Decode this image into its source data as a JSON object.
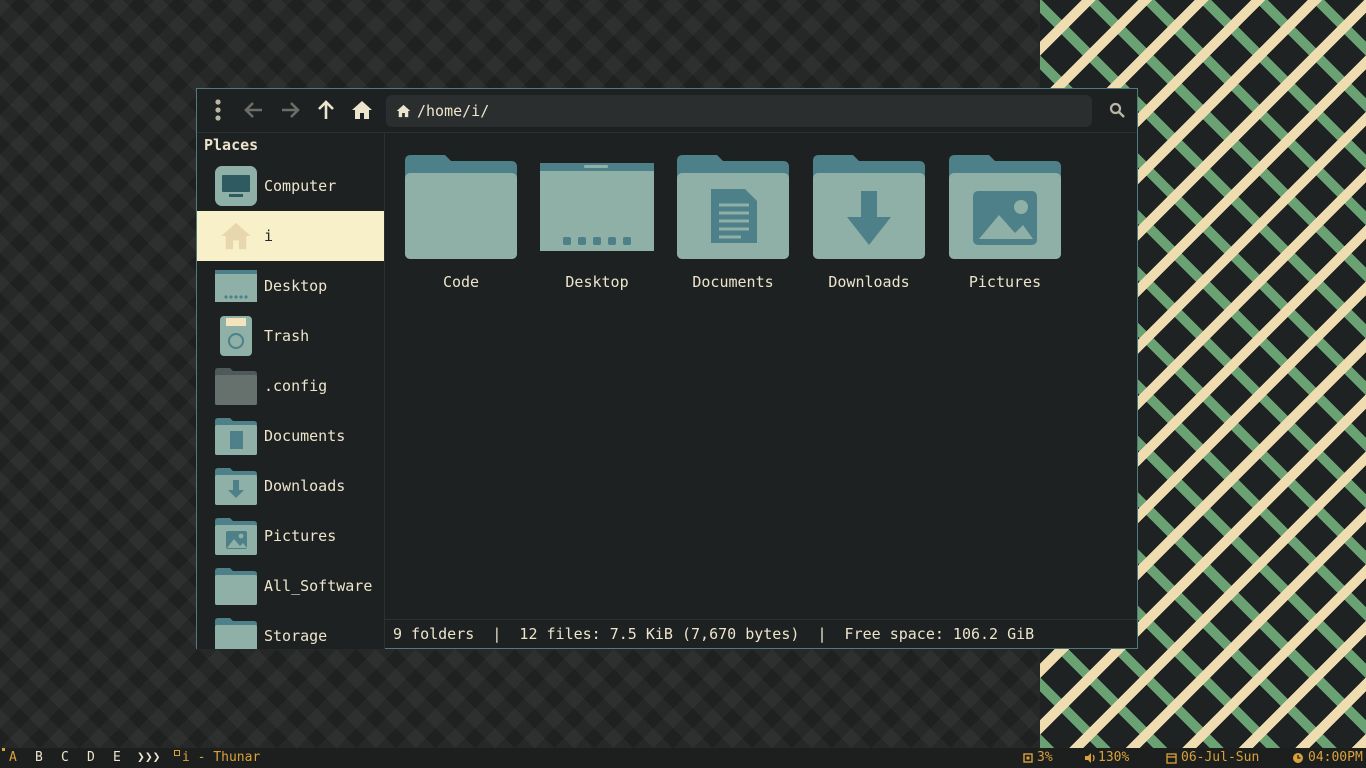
{
  "window": {
    "toolbar": {
      "path": "/home/i/",
      "icons": [
        "menu-icon",
        "back-icon",
        "forward-icon",
        "up-icon",
        "home-icon",
        "search-icon"
      ]
    },
    "sidebar": {
      "title": "Places",
      "items": [
        {
          "label": "Computer",
          "icon": "computer-icon"
        },
        {
          "label": "i",
          "icon": "home-icon",
          "active": true
        },
        {
          "label": "Desktop",
          "icon": "desktop-icon"
        },
        {
          "label": "Trash",
          "icon": "trash-icon"
        },
        {
          "label": ".config",
          "icon": "folder-icon"
        },
        {
          "label": "Documents",
          "icon": "documents-folder-icon"
        },
        {
          "label": "Downloads",
          "icon": "downloads-folder-icon"
        },
        {
          "label": "Pictures",
          "icon": "pictures-folder-icon"
        },
        {
          "label": "All_Software",
          "icon": "folder-icon"
        },
        {
          "label": "Storage",
          "icon": "folder-icon"
        }
      ]
    },
    "files": [
      {
        "name": "Code",
        "icon": "folder-icon"
      },
      {
        "name": "Desktop",
        "icon": "desktop-icon"
      },
      {
        "name": "Documents",
        "icon": "documents-folder-icon"
      },
      {
        "name": "Downloads",
        "icon": "downloads-folder-icon"
      },
      {
        "name": "Pictures",
        "icon": "pictures-folder-icon"
      }
    ],
    "status": "9 folders  |  12 files: 7.5 KiB (7,670 bytes)  |  Free space: 106.2 GiB"
  },
  "taskbar": {
    "workspaces": [
      "A",
      "B",
      "C",
      "D",
      "E"
    ],
    "separator": "❯❯❯",
    "active_window": "i - Thunar",
    "cpu": "3%",
    "volume": "130%",
    "date": "06-Jul-Sun",
    "time": "04:00PM"
  },
  "colors": {
    "accent": "#4f7a7e",
    "folder_light": "#8fb0a6",
    "folder_dark": "#4d8088",
    "active_bg": "#f7f0c8",
    "text": "#ece4cc",
    "tray": "#d9a23a"
  }
}
